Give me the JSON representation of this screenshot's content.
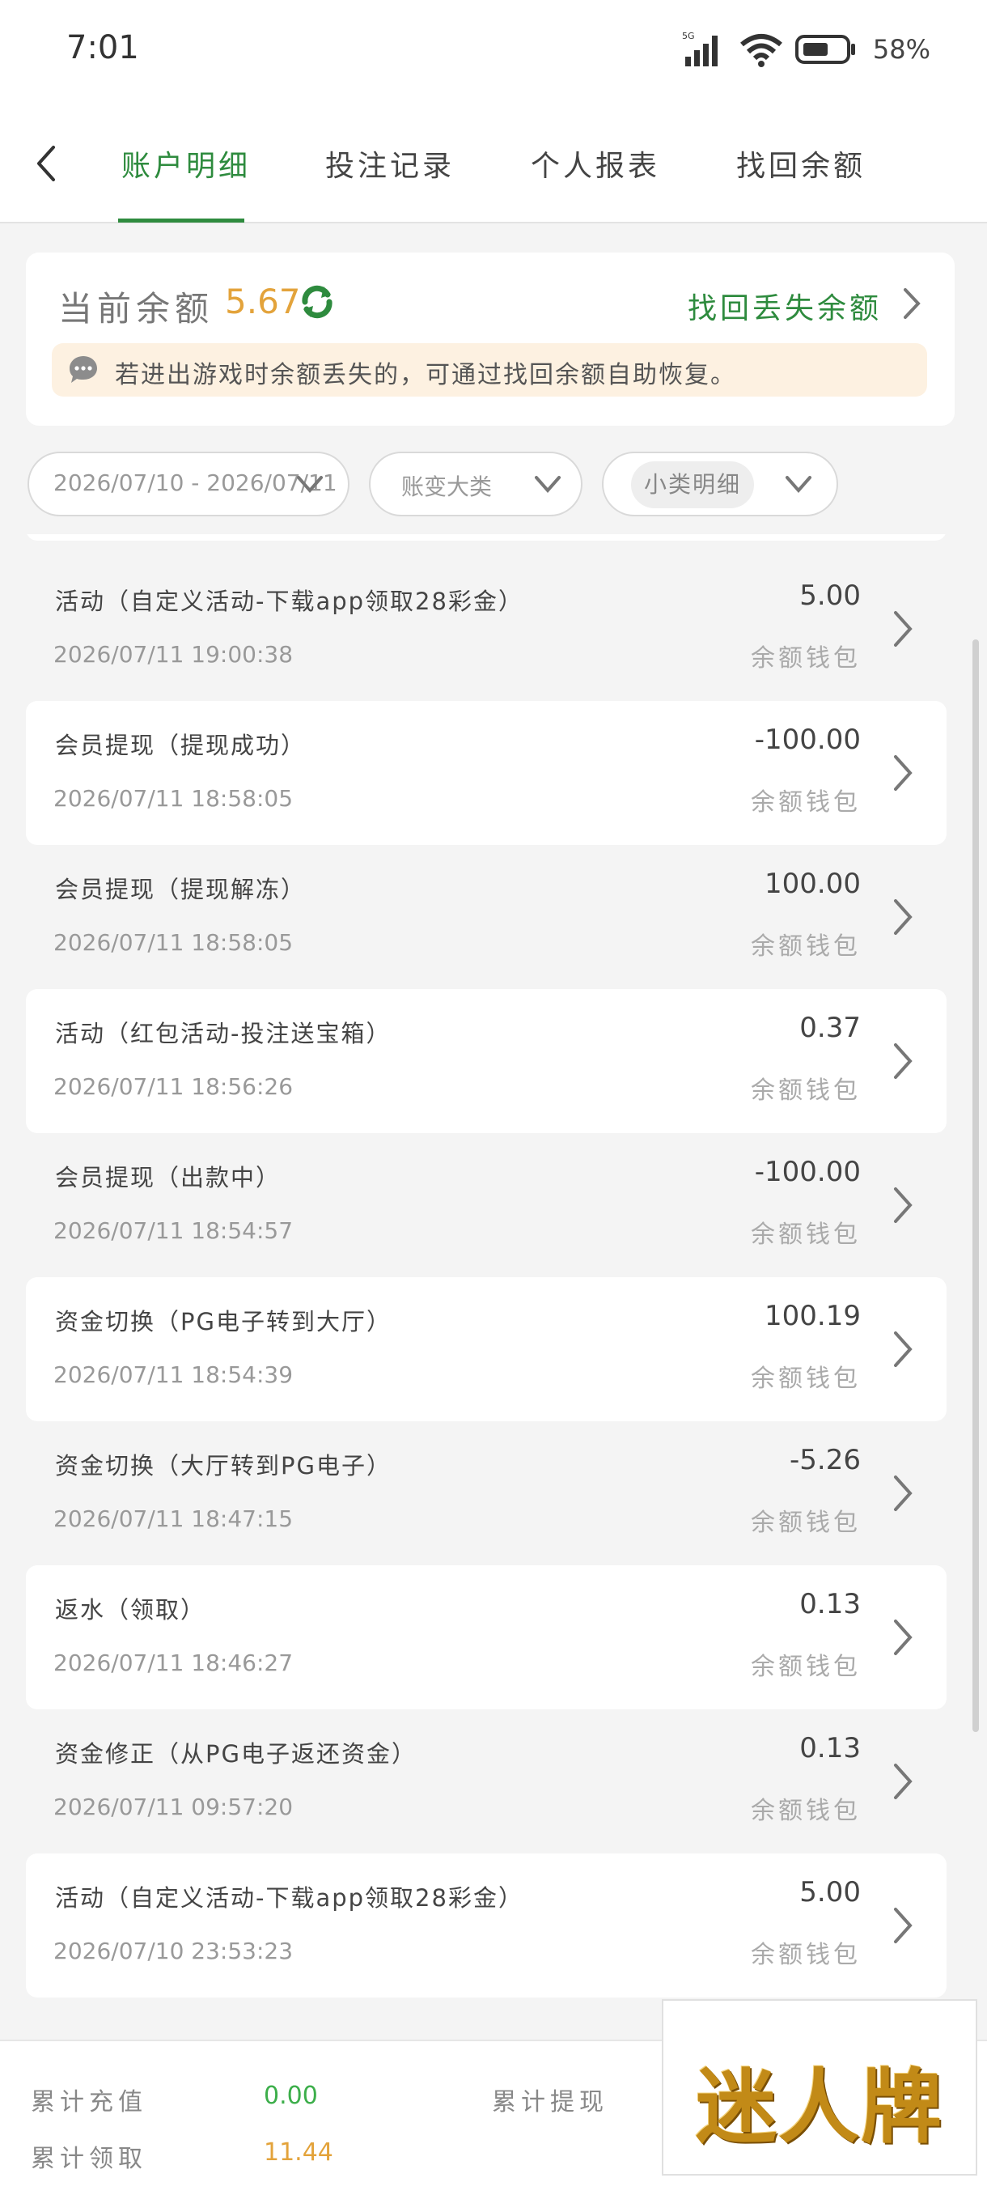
{
  "status_bar": {
    "time": "7:01",
    "network": "5G",
    "battery": "58%"
  },
  "tabs": [
    {
      "label": "账户明细",
      "active": true
    },
    {
      "label": "投注记录",
      "active": false
    },
    {
      "label": "个人报表",
      "active": false
    },
    {
      "label": "找回余额",
      "active": false
    }
  ],
  "balance": {
    "label": "当前余额",
    "value": "5.67",
    "retrieve_label": "找回丢失余额",
    "notice": "若进出游戏时余额丢失的，可通过找回余额自助恢复。"
  },
  "filters": {
    "date_range": "2026/07/10 - 2026/07/11",
    "category": "账变大类",
    "subcategory": "小类明细"
  },
  "transactions": [
    {
      "title": "活动（自定义活动-下载app领取28彩金）",
      "time": "2026/07/11 19:00:38",
      "amount": "5.00",
      "wallet": "余额钱包"
    },
    {
      "title": "会员提现（提现成功）",
      "time": "2026/07/11 18:58:05",
      "amount": "-100.00",
      "wallet": "余额钱包"
    },
    {
      "title": "会员提现（提现解冻）",
      "time": "2026/07/11 18:58:05",
      "amount": "100.00",
      "wallet": "余额钱包"
    },
    {
      "title": "活动（红包活动-投注送宝箱）",
      "time": "2026/07/11 18:56:26",
      "amount": "0.37",
      "wallet": "余额钱包"
    },
    {
      "title": "会员提现（出款中）",
      "time": "2026/07/11 18:54:57",
      "amount": "-100.00",
      "wallet": "余额钱包"
    },
    {
      "title": "资金切换（PG电子转到大厅）",
      "time": "2026/07/11 18:54:39",
      "amount": "100.19",
      "wallet": "余额钱包"
    },
    {
      "title": "资金切换（大厅转到PG电子）",
      "time": "2026/07/11 18:47:15",
      "amount": "-5.26",
      "wallet": "余额钱包"
    },
    {
      "title": "返水（领取）",
      "time": "2026/07/11 18:46:27",
      "amount": "0.13",
      "wallet": "余额钱包"
    },
    {
      "title": "资金修正（从PG电子返还资金）",
      "time": "2026/07/11 09:57:20",
      "amount": "0.13",
      "wallet": "余额钱包"
    },
    {
      "title": "活动（自定义活动-下载app领取28彩金）",
      "time": "2026/07/10 23:53:23",
      "amount": "5.00",
      "wallet": "余额钱包"
    }
  ],
  "summary": {
    "recharge_label": "累计充值",
    "recharge_value": "0.00",
    "withdraw_label": "累计提现",
    "claim_label": "累计领取",
    "claim_value": "11.44"
  },
  "watermark": "迷人牌",
  "colors": {
    "accent_green": "#2e8b3e",
    "balance_gold": "#e3a33b",
    "claim_gold": "#e3a33b",
    "recharge_green": "#3cae4a"
  }
}
